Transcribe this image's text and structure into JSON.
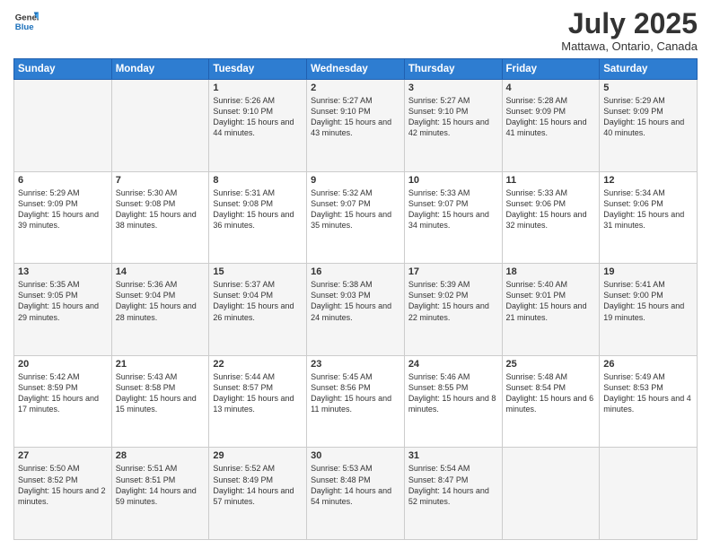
{
  "logo": {
    "line1": "General",
    "line2": "Blue"
  },
  "title": "July 2025",
  "location": "Mattawa, Ontario, Canada",
  "days_of_week": [
    "Sunday",
    "Monday",
    "Tuesday",
    "Wednesday",
    "Thursday",
    "Friday",
    "Saturday"
  ],
  "weeks": [
    [
      {
        "day": "",
        "sunrise": "",
        "sunset": "",
        "daylight": ""
      },
      {
        "day": "",
        "sunrise": "",
        "sunset": "",
        "daylight": ""
      },
      {
        "day": "1",
        "sunrise": "Sunrise: 5:26 AM",
        "sunset": "Sunset: 9:10 PM",
        "daylight": "Daylight: 15 hours and 44 minutes."
      },
      {
        "day": "2",
        "sunrise": "Sunrise: 5:27 AM",
        "sunset": "Sunset: 9:10 PM",
        "daylight": "Daylight: 15 hours and 43 minutes."
      },
      {
        "day": "3",
        "sunrise": "Sunrise: 5:27 AM",
        "sunset": "Sunset: 9:10 PM",
        "daylight": "Daylight: 15 hours and 42 minutes."
      },
      {
        "day": "4",
        "sunrise": "Sunrise: 5:28 AM",
        "sunset": "Sunset: 9:09 PM",
        "daylight": "Daylight: 15 hours and 41 minutes."
      },
      {
        "day": "5",
        "sunrise": "Sunrise: 5:29 AM",
        "sunset": "Sunset: 9:09 PM",
        "daylight": "Daylight: 15 hours and 40 minutes."
      }
    ],
    [
      {
        "day": "6",
        "sunrise": "Sunrise: 5:29 AM",
        "sunset": "Sunset: 9:09 PM",
        "daylight": "Daylight: 15 hours and 39 minutes."
      },
      {
        "day": "7",
        "sunrise": "Sunrise: 5:30 AM",
        "sunset": "Sunset: 9:08 PM",
        "daylight": "Daylight: 15 hours and 38 minutes."
      },
      {
        "day": "8",
        "sunrise": "Sunrise: 5:31 AM",
        "sunset": "Sunset: 9:08 PM",
        "daylight": "Daylight: 15 hours and 36 minutes."
      },
      {
        "day": "9",
        "sunrise": "Sunrise: 5:32 AM",
        "sunset": "Sunset: 9:07 PM",
        "daylight": "Daylight: 15 hours and 35 minutes."
      },
      {
        "day": "10",
        "sunrise": "Sunrise: 5:33 AM",
        "sunset": "Sunset: 9:07 PM",
        "daylight": "Daylight: 15 hours and 34 minutes."
      },
      {
        "day": "11",
        "sunrise": "Sunrise: 5:33 AM",
        "sunset": "Sunset: 9:06 PM",
        "daylight": "Daylight: 15 hours and 32 minutes."
      },
      {
        "day": "12",
        "sunrise": "Sunrise: 5:34 AM",
        "sunset": "Sunset: 9:06 PM",
        "daylight": "Daylight: 15 hours and 31 minutes."
      }
    ],
    [
      {
        "day": "13",
        "sunrise": "Sunrise: 5:35 AM",
        "sunset": "Sunset: 9:05 PM",
        "daylight": "Daylight: 15 hours and 29 minutes."
      },
      {
        "day": "14",
        "sunrise": "Sunrise: 5:36 AM",
        "sunset": "Sunset: 9:04 PM",
        "daylight": "Daylight: 15 hours and 28 minutes."
      },
      {
        "day": "15",
        "sunrise": "Sunrise: 5:37 AM",
        "sunset": "Sunset: 9:04 PM",
        "daylight": "Daylight: 15 hours and 26 minutes."
      },
      {
        "day": "16",
        "sunrise": "Sunrise: 5:38 AM",
        "sunset": "Sunset: 9:03 PM",
        "daylight": "Daylight: 15 hours and 24 minutes."
      },
      {
        "day": "17",
        "sunrise": "Sunrise: 5:39 AM",
        "sunset": "Sunset: 9:02 PM",
        "daylight": "Daylight: 15 hours and 22 minutes."
      },
      {
        "day": "18",
        "sunrise": "Sunrise: 5:40 AM",
        "sunset": "Sunset: 9:01 PM",
        "daylight": "Daylight: 15 hours and 21 minutes."
      },
      {
        "day": "19",
        "sunrise": "Sunrise: 5:41 AM",
        "sunset": "Sunset: 9:00 PM",
        "daylight": "Daylight: 15 hours and 19 minutes."
      }
    ],
    [
      {
        "day": "20",
        "sunrise": "Sunrise: 5:42 AM",
        "sunset": "Sunset: 8:59 PM",
        "daylight": "Daylight: 15 hours and 17 minutes."
      },
      {
        "day": "21",
        "sunrise": "Sunrise: 5:43 AM",
        "sunset": "Sunset: 8:58 PM",
        "daylight": "Daylight: 15 hours and 15 minutes."
      },
      {
        "day": "22",
        "sunrise": "Sunrise: 5:44 AM",
        "sunset": "Sunset: 8:57 PM",
        "daylight": "Daylight: 15 hours and 13 minutes."
      },
      {
        "day": "23",
        "sunrise": "Sunrise: 5:45 AM",
        "sunset": "Sunset: 8:56 PM",
        "daylight": "Daylight: 15 hours and 11 minutes."
      },
      {
        "day": "24",
        "sunrise": "Sunrise: 5:46 AM",
        "sunset": "Sunset: 8:55 PM",
        "daylight": "Daylight: 15 hours and 8 minutes."
      },
      {
        "day": "25",
        "sunrise": "Sunrise: 5:48 AM",
        "sunset": "Sunset: 8:54 PM",
        "daylight": "Daylight: 15 hours and 6 minutes."
      },
      {
        "day": "26",
        "sunrise": "Sunrise: 5:49 AM",
        "sunset": "Sunset: 8:53 PM",
        "daylight": "Daylight: 15 hours and 4 minutes."
      }
    ],
    [
      {
        "day": "27",
        "sunrise": "Sunrise: 5:50 AM",
        "sunset": "Sunset: 8:52 PM",
        "daylight": "Daylight: 15 hours and 2 minutes."
      },
      {
        "day": "28",
        "sunrise": "Sunrise: 5:51 AM",
        "sunset": "Sunset: 8:51 PM",
        "daylight": "Daylight: 14 hours and 59 minutes."
      },
      {
        "day": "29",
        "sunrise": "Sunrise: 5:52 AM",
        "sunset": "Sunset: 8:49 PM",
        "daylight": "Daylight: 14 hours and 57 minutes."
      },
      {
        "day": "30",
        "sunrise": "Sunrise: 5:53 AM",
        "sunset": "Sunset: 8:48 PM",
        "daylight": "Daylight: 14 hours and 54 minutes."
      },
      {
        "day": "31",
        "sunrise": "Sunrise: 5:54 AM",
        "sunset": "Sunset: 8:47 PM",
        "daylight": "Daylight: 14 hours and 52 minutes."
      },
      {
        "day": "",
        "sunrise": "",
        "sunset": "",
        "daylight": ""
      },
      {
        "day": "",
        "sunrise": "",
        "sunset": "",
        "daylight": ""
      }
    ]
  ]
}
